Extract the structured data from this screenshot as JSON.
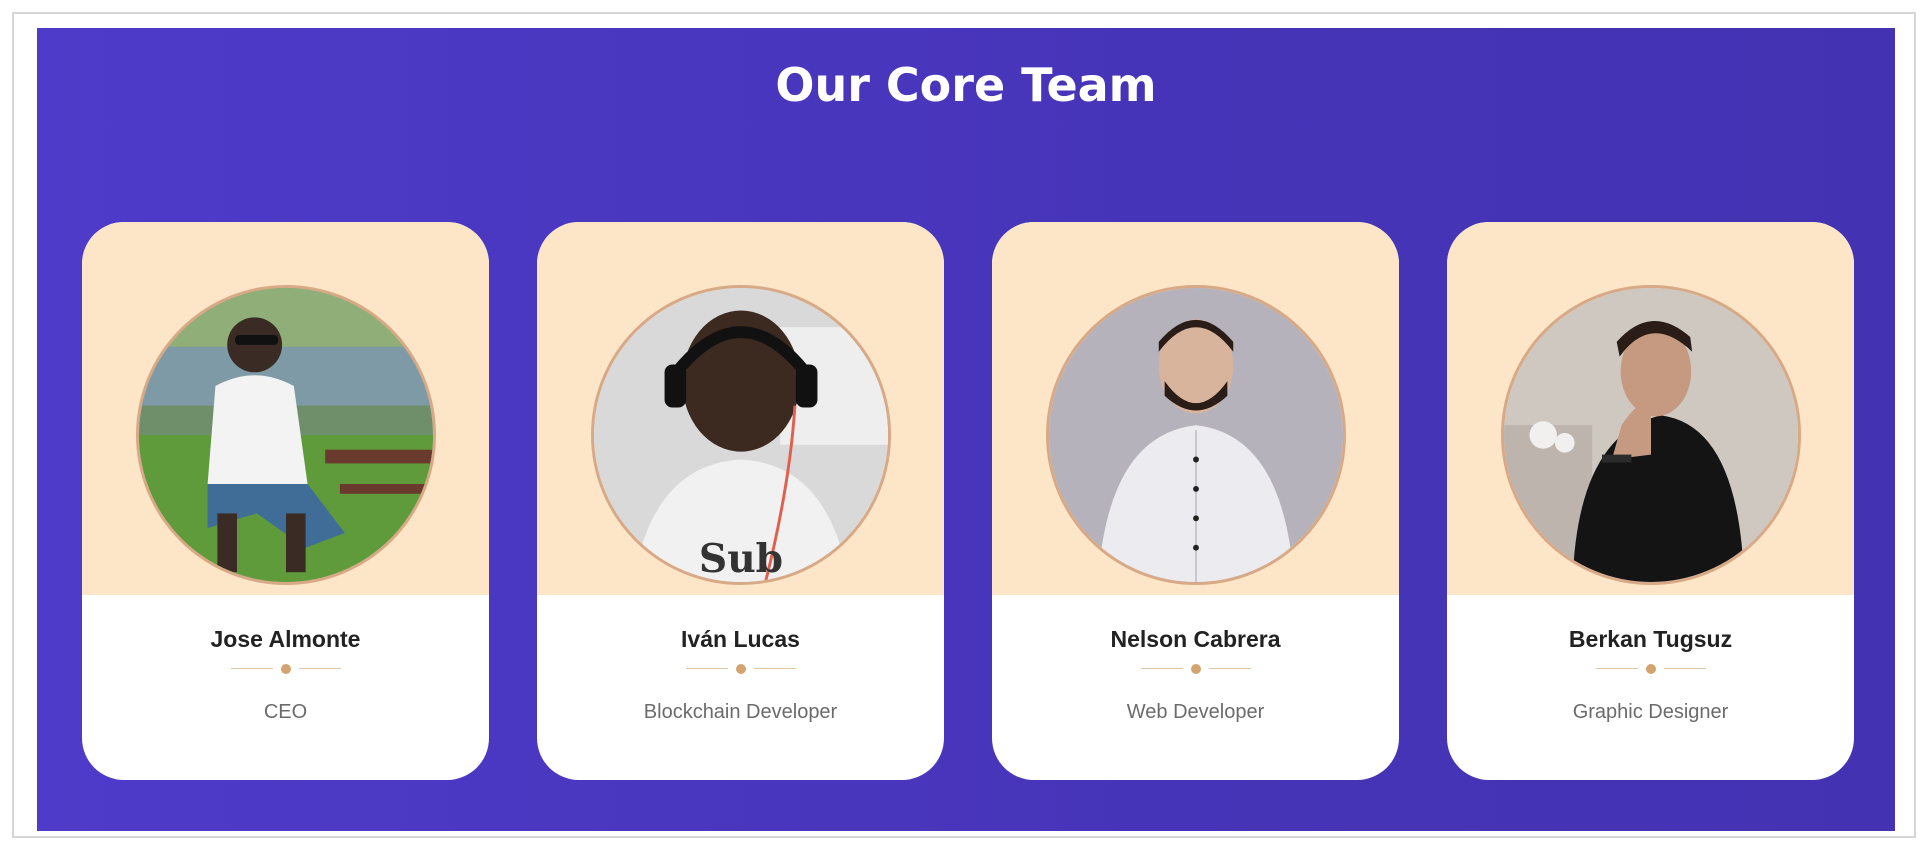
{
  "section": {
    "title": "Our Core Team"
  },
  "colors": {
    "background": "#4a38c0",
    "card_top": "#fde6c7",
    "accent": "#d3a370",
    "title_text": "#ffffff"
  },
  "team": [
    {
      "name": "Jose Almonte",
      "role": "CEO",
      "photo": "person-photo-outdoor"
    },
    {
      "name": "Iván Lucas",
      "role": "Blockchain Developer",
      "photo": "person-photo-headphones"
    },
    {
      "name": "Nelson Cabrera",
      "role": "Web Developer",
      "photo": "person-photo-white-shirt"
    },
    {
      "name": "Berkan Tugsuz",
      "role": "Graphic Designer",
      "photo": "person-photo-black-shirt"
    }
  ]
}
